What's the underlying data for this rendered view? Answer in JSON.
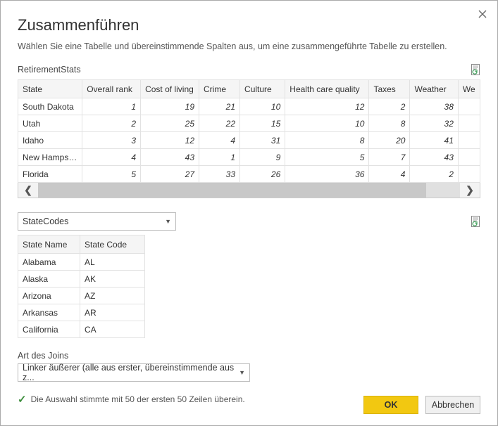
{
  "title": "Zusammenführen",
  "subtitle": "Wählen Sie eine Tabelle und übereinstimmende Spalten aus, um eine zusammengeführte Tabelle zu erstellen.",
  "table1": {
    "name": "RetirementStats",
    "columns": [
      "State",
      "Overall rank",
      "Cost of living",
      "Crime",
      "Culture",
      "Health care quality",
      "Taxes",
      "Weather",
      "We"
    ],
    "rows": [
      {
        "state": "South Dakota",
        "vals": [
          1,
          19,
          21,
          10,
          12,
          2,
          38
        ]
      },
      {
        "state": "Utah",
        "vals": [
          2,
          25,
          22,
          15,
          10,
          8,
          32
        ]
      },
      {
        "state": "Idaho",
        "vals": [
          3,
          12,
          4,
          31,
          8,
          20,
          41
        ]
      },
      {
        "state": "New Hampshire",
        "vals": [
          4,
          43,
          1,
          9,
          5,
          7,
          43
        ]
      },
      {
        "state": "Florida",
        "vals": [
          5,
          27,
          33,
          26,
          36,
          4,
          2
        ]
      }
    ]
  },
  "table2_selector": "StateCodes",
  "table2": {
    "columns": [
      "State Name",
      "State Code"
    ],
    "rows": [
      {
        "name": "Alabama",
        "code": "AL"
      },
      {
        "name": "Alaska",
        "code": "AK"
      },
      {
        "name": "Arizona",
        "code": "AZ"
      },
      {
        "name": "Arkansas",
        "code": "AR"
      },
      {
        "name": "California",
        "code": "CA"
      }
    ]
  },
  "join": {
    "label": "Art des Joins",
    "selected": "Linker äußerer (alle aus erster, übereinstimmende aus z..."
  },
  "status": "Die Auswahl stimmte mit 50 der ersten 50 Zeilen überein.",
  "buttons": {
    "ok": "OK",
    "cancel": "Abbrechen"
  }
}
